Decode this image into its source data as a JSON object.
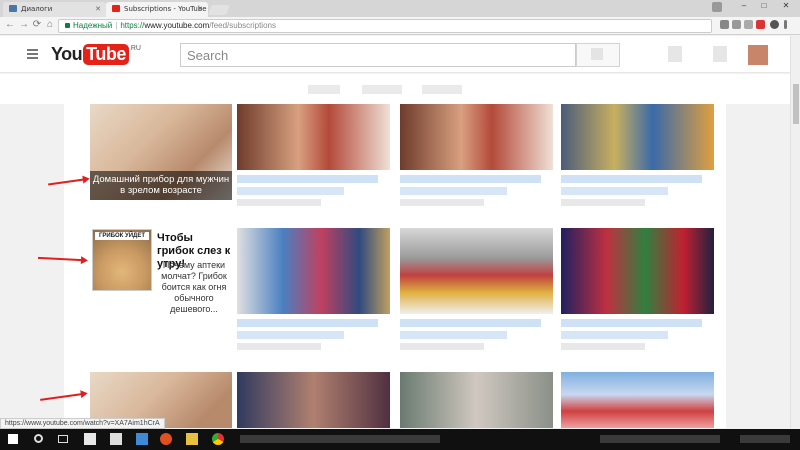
{
  "browser": {
    "tabs": [
      {
        "label": "Диалоги",
        "state": "inactive"
      },
      {
        "label": "Subscriptions - YouTube",
        "state": "active"
      }
    ],
    "window_controls": {
      "minimize": "–",
      "maximize": "□",
      "close": "✕"
    },
    "nav": {
      "back": "←",
      "forward": "→",
      "reload": "⟳",
      "home": "⌂"
    },
    "address": {
      "secure_label": "Надежный",
      "scheme": "https://",
      "host": "www.youtube.com",
      "path": "/feed/subscriptions"
    },
    "status_url": "https://www.youtube.com/watch?v=XA7Aim1hCrA"
  },
  "youtube": {
    "logo_you": "You",
    "logo_tube": "Tube",
    "logo_region": "RU",
    "search_placeholder": "Search"
  },
  "ads": [
    {
      "caption": "Домашний прибор для мужчин в зрелом возрасте"
    },
    {
      "badge": "ГРИБОК УЙДЕТ",
      "title": "Чтобы грибок слез к утру!",
      "text": "Почему аптеки молчат? Грибок боится как огня обычного дешевого..."
    }
  ],
  "colors": {
    "accent_red": "#e62117",
    "secure_green": "#0b8043",
    "arrow_red": "#e02020",
    "link_blue": "#cfe1f5"
  },
  "icons": {
    "menu": "hamburger-icon",
    "taskbar": [
      "windows-start-icon",
      "search-icon",
      "task-view-icon",
      "store-icon",
      "amazon-icon",
      "dropbox-icon",
      "media-icon",
      "explorer-icon",
      "chrome-icon"
    ]
  }
}
